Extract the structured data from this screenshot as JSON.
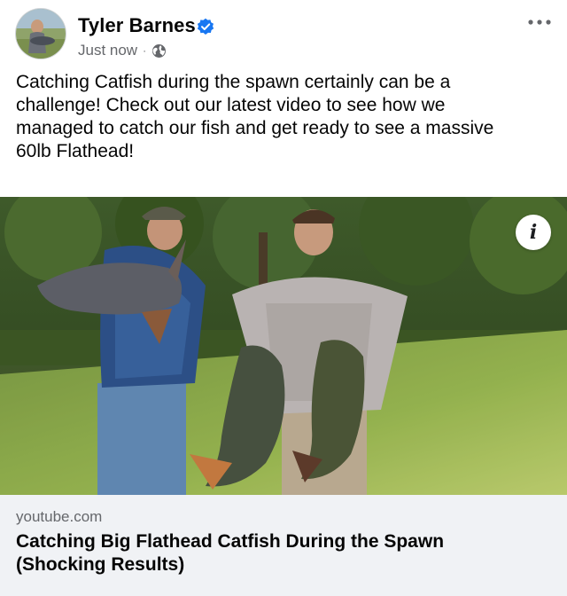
{
  "post": {
    "author": "Tyler Barnes",
    "timestamp": "Just now",
    "separator": "·",
    "audience_icon": "globe-icon",
    "verified_icon": "verified-badge-icon",
    "more_icon": "more-horizontal-icon",
    "text": "Catching Catfish during the spawn certainly can be a\nchallenge! Check out our latest video to see how we\nmanaged to catch our fish and get ready to see a massive\n60lb Flathead!"
  },
  "link_preview": {
    "domain": "youtube.com",
    "title": "Catching Big Flathead Catfish During the Spawn\n(Shocking Results)",
    "info_glyph": "i"
  },
  "colors": {
    "text": "#050505",
    "secondary_text": "#65676b",
    "verified_blue": "#1877f2",
    "card_background": "#f0f2f5"
  }
}
